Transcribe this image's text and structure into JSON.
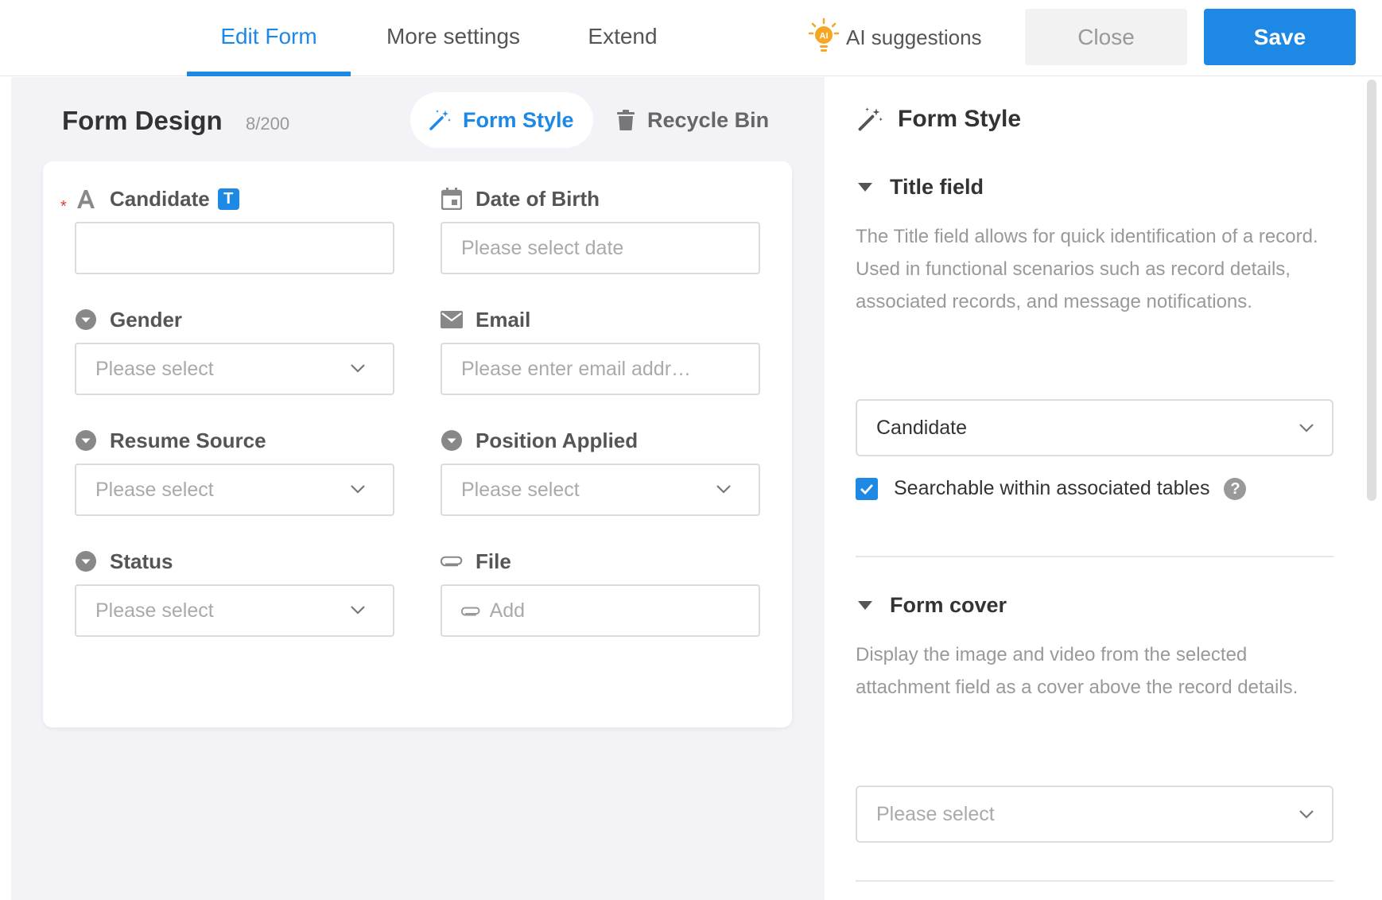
{
  "tabs": [
    {
      "label": "Edit Form",
      "active": true
    },
    {
      "label": "More settings",
      "active": false
    },
    {
      "label": "Extend",
      "active": false
    }
  ],
  "ai": {
    "label": "AI suggestions",
    "badge": "AI"
  },
  "actions": {
    "close": "Close",
    "save": "Save"
  },
  "design": {
    "title": "Form Design",
    "count": "8/200",
    "form_style_button": "Form Style",
    "recycle_bin": "Recycle Bin"
  },
  "fields": [
    {
      "label": "Candidate",
      "icon": "text-icon",
      "required": true,
      "badge": "T",
      "placeholder": "",
      "control": "text"
    },
    {
      "label": "Date of Birth",
      "icon": "calendar-icon",
      "required": false,
      "placeholder": "Please select date",
      "control": "date"
    },
    {
      "label": "Gender",
      "icon": "dropdown-circle-icon",
      "required": false,
      "placeholder": "Please select",
      "control": "select"
    },
    {
      "label": "Email",
      "icon": "envelope-icon",
      "required": false,
      "placeholder": "Please enter email addr…",
      "control": "text"
    },
    {
      "label": "Resume Source",
      "icon": "dropdown-circle-icon",
      "required": false,
      "placeholder": "Please select",
      "control": "select"
    },
    {
      "label": "Position Applied",
      "icon": "dropdown-circle-icon",
      "required": false,
      "placeholder": "Please select",
      "control": "select"
    },
    {
      "label": "Status",
      "icon": "dropdown-circle-icon",
      "required": false,
      "placeholder": "Please select",
      "control": "select"
    },
    {
      "label": "File",
      "icon": "paperclip-icon",
      "required": false,
      "placeholder": "Add",
      "control": "file"
    }
  ],
  "panel": {
    "title": "Form Style",
    "title_field": {
      "heading": "Title field",
      "description": "The Title field allows for quick identification of a record. Used in functional scenarios such as record details, associated records, and message notifications.",
      "selected": "Candidate",
      "searchable_label": "Searchable within associated tables",
      "searchable_checked": true
    },
    "form_cover": {
      "heading": "Form cover",
      "description": "Display the image and video from the selected attachment field as a cover above the record details.",
      "placeholder": "Please select"
    }
  },
  "colors": {
    "accent": "#1e88e5",
    "required": "#e53935",
    "ai_bulb": "#f5a623"
  }
}
